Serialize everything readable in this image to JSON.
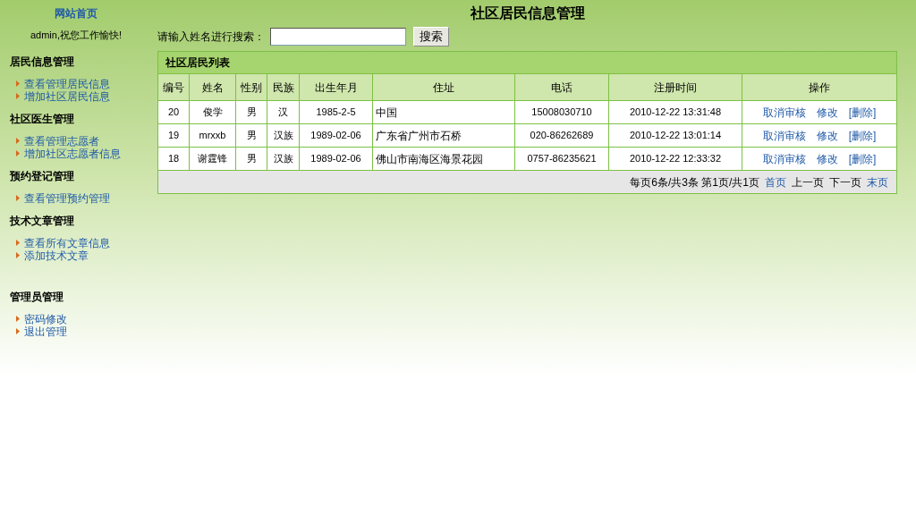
{
  "sidebar": {
    "home_link": "网站首页",
    "greeting": "admin,祝您工作愉快!",
    "sections": [
      {
        "title": "居民信息管理",
        "items": [
          "查看管理居民信息",
          "增加社区居民信息"
        ]
      },
      {
        "title": "社区医生管理",
        "items": [
          "查看管理志愿者",
          "增加社区志愿者信息"
        ]
      },
      {
        "title": "预约登记管理",
        "items": [
          "查看管理预约管理"
        ]
      },
      {
        "title": "技术文章管理",
        "items": [
          "查看所有文章信息",
          "添加技术文章"
        ]
      },
      {
        "title": "管理员管理",
        "items": [
          "密码修改",
          "退出管理"
        ]
      }
    ]
  },
  "page_title": "社区居民信息管理",
  "search": {
    "label": "请输入姓名进行搜索：",
    "button": "搜索"
  },
  "table": {
    "title": "社区居民列表",
    "columns": [
      "编号",
      "姓名",
      "性别",
      "民族",
      "出生年月",
      "住址",
      "电话",
      "注册时间",
      "操作"
    ],
    "rows": [
      {
        "cells": [
          "20",
          "俊学",
          "男",
          "汉",
          "1985-2-5",
          "中国",
          "15008030710",
          "2010-12-22 13:31:48"
        ],
        "actions": [
          "取消审核",
          "修改",
          "[删除]"
        ]
      },
      {
        "cells": [
          "19",
          "mrxxb",
          "男",
          "汉族",
          "1989-02-06",
          "广东省广州市石桥",
          "020-86262689",
          "2010-12-22 13:01:14"
        ],
        "actions": [
          "取消审核",
          "修改",
          "[删除]"
        ]
      },
      {
        "cells": [
          "18",
          "谢霆锋",
          "男",
          "汉族",
          "1989-02-06",
          "佛山市南海区海景花园",
          "0757-86235621",
          "2010-12-22 12:33:32"
        ],
        "actions": [
          "取消审核",
          "修改",
          "[删除]"
        ]
      }
    ],
    "pager": {
      "summary": "每页6条/共3条 第1页/共1页",
      "links": [
        {
          "label": "首页",
          "disabled": false
        },
        {
          "label": "上一页",
          "disabled": true
        },
        {
          "label": "下一页",
          "disabled": true
        },
        {
          "label": "末页",
          "disabled": false
        }
      ]
    }
  }
}
